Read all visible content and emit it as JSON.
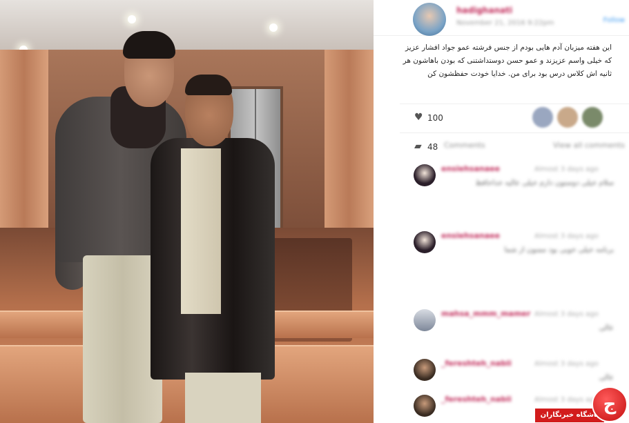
{
  "post": {
    "username": "hadighanati",
    "date": "November 21, 2016 9:22pm",
    "follow_label": "Follow",
    "caption": "این هفته میزبان آدم هایی بودم از جنس فرشته عمو جواد افشار عزیز که خیلی واسم عزیزند و عمو حسن دوستداشتنی که بودن باهاشون هر ثانیه اش کلاس درس بود برای من. خدایا خودت حفظشون کن"
  },
  "stats": {
    "likes_icon": "heart-icon",
    "likes_count": "100",
    "comments_icon": "comment-icon",
    "comments_count": "48",
    "comments_label": "Comments",
    "view_all_label": "View all comments"
  },
  "comments": [
    {
      "username": "ensiehsanaee",
      "time": "Almost 3 days ago",
      "text": "سلام خیلی دوستون دارم خیلی عالیه خداحافظ"
    },
    {
      "username": "ensiehsanaee",
      "time": "Almost 3 days ago",
      "text": "برنامه خیلی خوبی بود ممنون از شما"
    },
    {
      "username": "mahsa_mmm_mamer",
      "time": "Almost 3 days ago",
      "text": "عالی"
    },
    {
      "username": "_fereshteh_nabii",
      "time": "Almost 3 days ago",
      "text": "عالی"
    },
    {
      "username": "_fereshteh_nabii",
      "time": "Almost 3 days ago",
      "text": ""
    }
  ],
  "watermark": {
    "bar_text": "باشگاه خبرنگاران",
    "logo_glyph": "ج"
  }
}
